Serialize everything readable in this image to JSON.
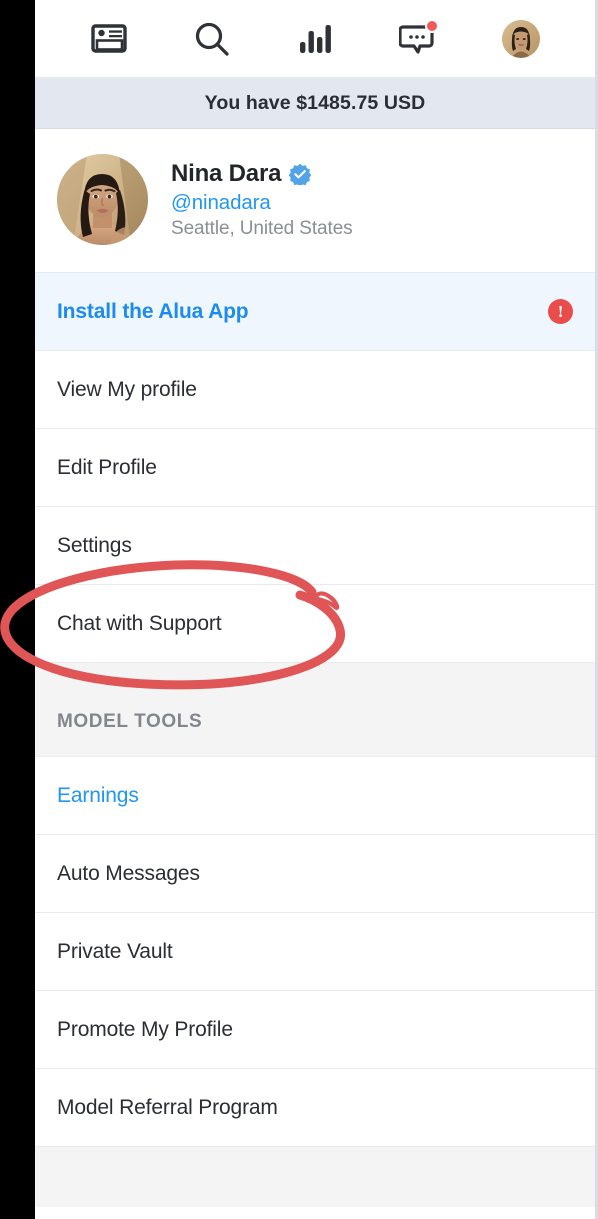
{
  "navbar": {
    "items": [
      {
        "name": "feed-icon",
        "label": "Feed"
      },
      {
        "name": "search-icon",
        "label": "Search"
      },
      {
        "name": "stats-icon",
        "label": "Stats"
      },
      {
        "name": "messages-icon",
        "label": "Messages",
        "has_badge": true
      },
      {
        "name": "avatar",
        "label": "Profile"
      }
    ]
  },
  "balance": {
    "text": "You have $1485.75 USD"
  },
  "profile": {
    "name": "Nina Dara",
    "verified": true,
    "handle": "@ninadara",
    "location": "Seattle, United States"
  },
  "menu": {
    "promo": {
      "label": "Install the Alua App",
      "alert_glyph": "!"
    },
    "items": [
      {
        "label": "View My profile"
      },
      {
        "label": "Edit Profile"
      },
      {
        "label": "Settings"
      },
      {
        "label": "Chat with Support"
      }
    ]
  },
  "model_tools": {
    "header": "MODEL TOOLS",
    "items": [
      {
        "label": "Earnings",
        "style": "link"
      },
      {
        "label": "Auto Messages",
        "style": "plain"
      },
      {
        "label": "Private Vault",
        "style": "plain"
      },
      {
        "label": "Promote My Profile",
        "style": "plain"
      },
      {
        "label": "Model Referral Program",
        "style": "plain"
      }
    ]
  },
  "annotation": {
    "type": "hand-drawn-ellipse",
    "target": "Chat with Support",
    "color": "#e05555"
  },
  "colors": {
    "accent_blue": "#2196f3",
    "banner_bg": "#e3e7ef",
    "promo_bg": "#eff6fd",
    "section_bg": "#f4f4f5",
    "alert_red": "#ea4b4b",
    "annotation_red": "#e05555"
  }
}
